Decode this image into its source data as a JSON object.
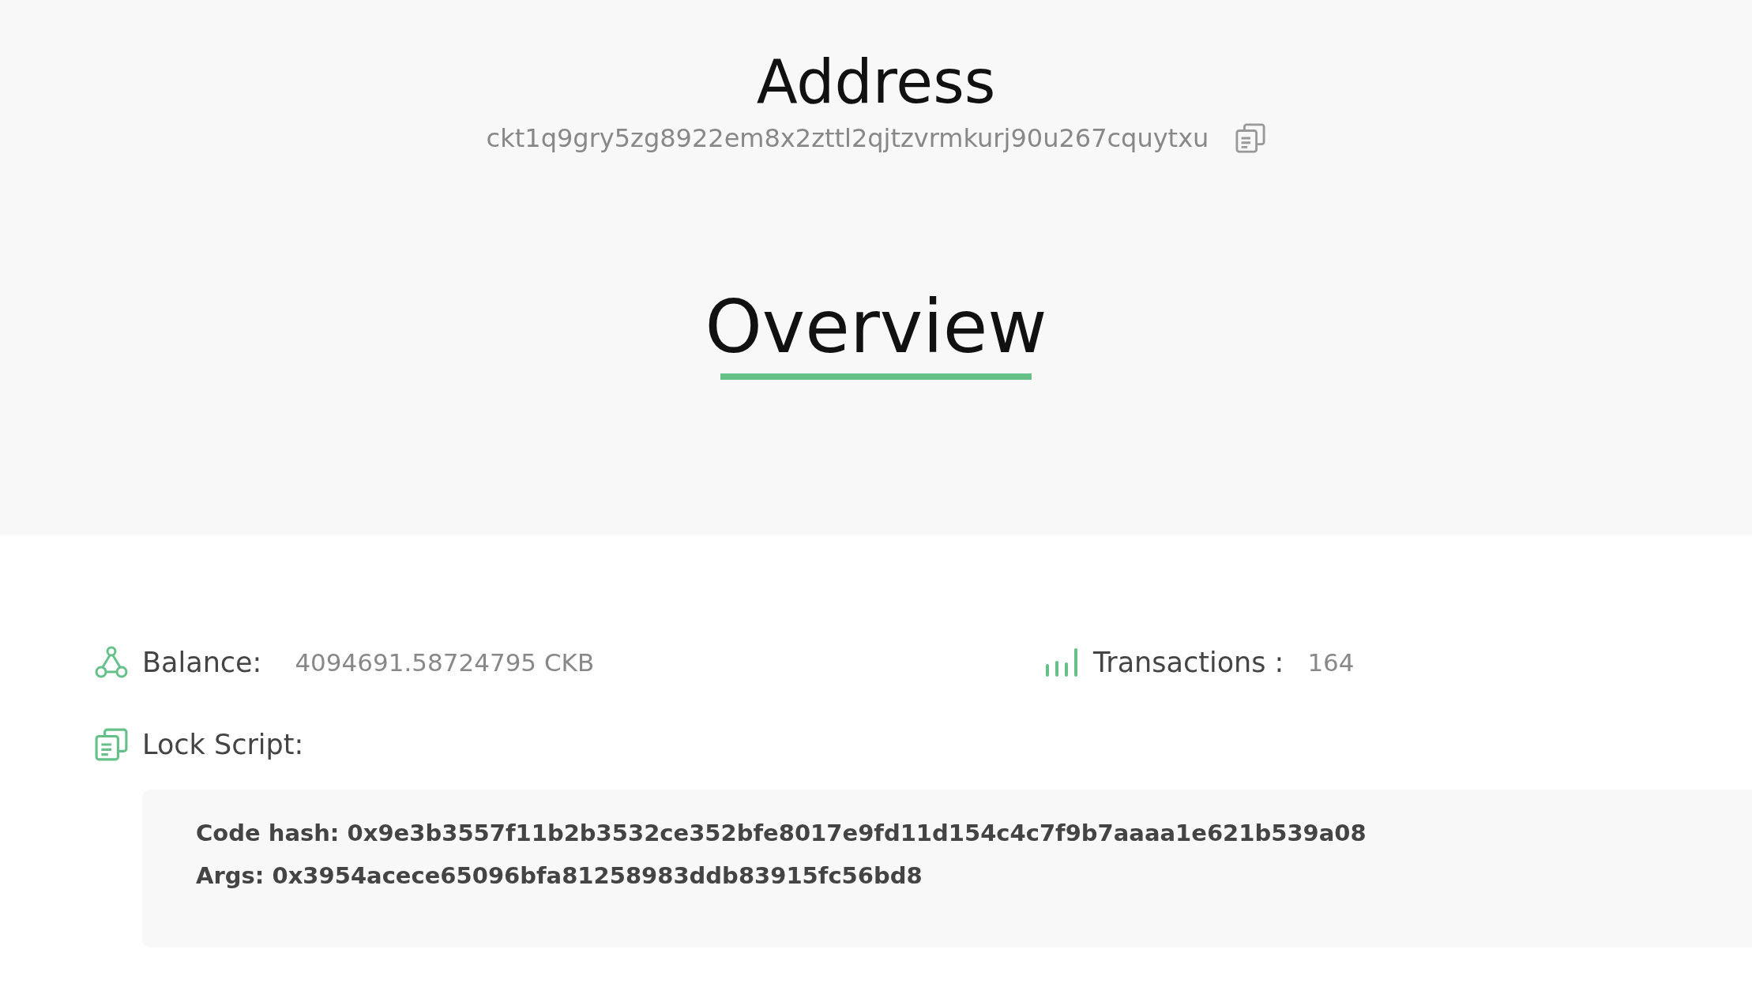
{
  "address": {
    "title": "Address",
    "hash": "ckt1q9gry5zg8922em8x2zttl2qjtzvrmkurj90u267cquytxu"
  },
  "tabs": [
    {
      "label": "Overview",
      "selected": true
    }
  ],
  "overview": {
    "balance": {
      "label": "Balance:",
      "value": "4094691.58724795 CKB"
    },
    "transactions": {
      "label": "Transactions :",
      "value": "164"
    },
    "lock_script": {
      "label": "Lock Script:",
      "lines": [
        "Code hash: 0x9e3b3557f11b2b3532ce352bfe8017e9fd11d154c4c7f9b7aaaa1e621b539a08",
        "Args: 0x3954acece65096bfa81258983ddb83915fc56bd8"
      ]
    }
  }
}
